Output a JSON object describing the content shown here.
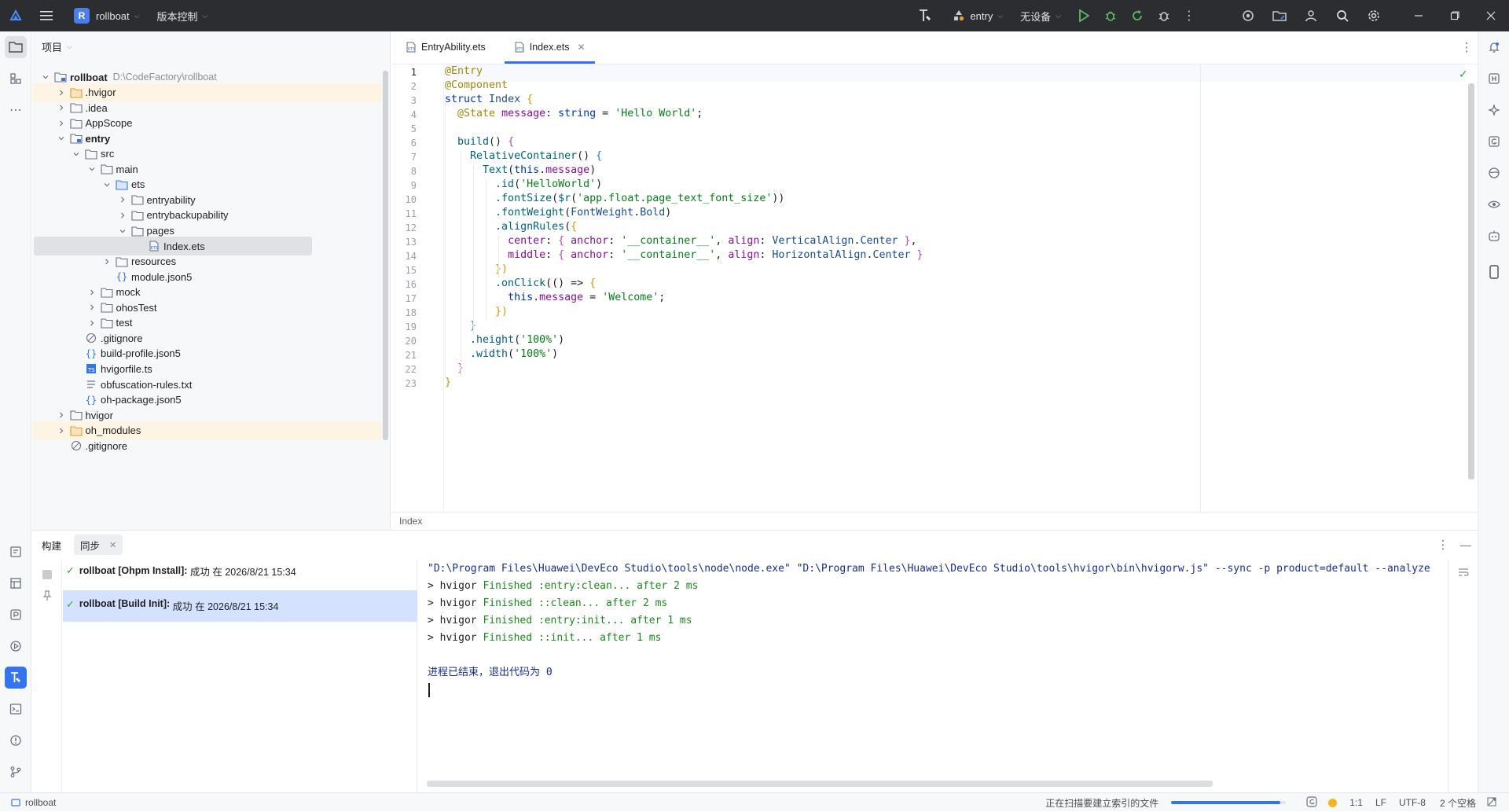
{
  "titlebar": {
    "project_name": "rollboat",
    "project_badge": "R",
    "vcs_label": "版本控制",
    "module": "entry",
    "device": "无设备"
  },
  "project_panel": {
    "title": "项目",
    "tree": [
      {
        "label": "rollboat",
        "hint": "D:\\CodeFactory\\rollboat",
        "depth": 0,
        "chevron": "down",
        "icon": "module-folder",
        "bold": true
      },
      {
        "label": ".hvigor",
        "depth": 1,
        "chevron": "right",
        "icon": "folder-orange",
        "highlight": true
      },
      {
        "label": ".idea",
        "depth": 1,
        "chevron": "right",
        "icon": "folder"
      },
      {
        "label": "AppScope",
        "depth": 1,
        "chevron": "right",
        "icon": "folder"
      },
      {
        "label": "entry",
        "depth": 1,
        "chevron": "down",
        "icon": "module-folder",
        "bold": true
      },
      {
        "label": "src",
        "depth": 2,
        "chevron": "down",
        "icon": "folder"
      },
      {
        "label": "main",
        "depth": 3,
        "chevron": "down",
        "icon": "folder"
      },
      {
        "label": "ets",
        "depth": 4,
        "chevron": "down",
        "icon": "folder-blue"
      },
      {
        "label": "entryability",
        "depth": 5,
        "chevron": "right",
        "icon": "folder"
      },
      {
        "label": "entrybackupability",
        "depth": 5,
        "chevron": "right",
        "icon": "folder"
      },
      {
        "label": "pages",
        "depth": 5,
        "chevron": "down",
        "icon": "folder"
      },
      {
        "label": "Index.ets",
        "depth": 6,
        "chevron": "",
        "icon": "ets-file",
        "selected": true
      },
      {
        "label": "resources",
        "depth": 4,
        "chevron": "right",
        "icon": "folder"
      },
      {
        "label": "module.json5",
        "depth": 4,
        "chevron": "",
        "icon": "json-file"
      },
      {
        "label": "mock",
        "depth": 3,
        "chevron": "right",
        "icon": "folder"
      },
      {
        "label": "ohosTest",
        "depth": 3,
        "chevron": "right",
        "icon": "folder"
      },
      {
        "label": "test",
        "depth": 3,
        "chevron": "right",
        "icon": "folder"
      },
      {
        "label": ".gitignore",
        "depth": 2,
        "chevron": "",
        "icon": "ignore-file"
      },
      {
        "label": "build-profile.json5",
        "depth": 2,
        "chevron": "",
        "icon": "json-file"
      },
      {
        "label": "hvigorfile.ts",
        "depth": 2,
        "chevron": "",
        "icon": "ts-file"
      },
      {
        "label": "obfuscation-rules.txt",
        "depth": 2,
        "chevron": "",
        "icon": "text-file"
      },
      {
        "label": "oh-package.json5",
        "depth": 2,
        "chevron": "",
        "icon": "json-file"
      },
      {
        "label": "hvigor",
        "depth": 1,
        "chevron": "right",
        "icon": "folder"
      },
      {
        "label": "oh_modules",
        "depth": 1,
        "chevron": "right",
        "icon": "folder-orange",
        "highlight": true
      },
      {
        "label": ".gitignore",
        "depth": 1,
        "chevron": "",
        "icon": "ignore-file"
      }
    ]
  },
  "editor": {
    "tabs": [
      {
        "label": "EntryAbility.ets",
        "active": false
      },
      {
        "label": "Index.ets",
        "active": true
      }
    ],
    "breadcrumb": "Index",
    "lines": [
      [
        {
          "t": "@Entry",
          "c": "dec"
        }
      ],
      [
        {
          "t": "@Component",
          "c": "dec"
        }
      ],
      [
        {
          "t": "struct ",
          "c": "kw"
        },
        {
          "t": "Index ",
          "c": "ty"
        },
        {
          "t": "{",
          "c": "br1"
        }
      ],
      [
        {
          "t": "  ",
          "c": "pl"
        },
        {
          "t": "@State ",
          "c": "dec"
        },
        {
          "t": "message",
          "c": "fld"
        },
        {
          "t": ": ",
          "c": "pl"
        },
        {
          "t": "string",
          "c": "kw"
        },
        {
          "t": " = ",
          "c": "pl"
        },
        {
          "t": "'Hello World'",
          "c": "str"
        },
        {
          "t": ";",
          "c": "pl"
        }
      ],
      [],
      [
        {
          "t": "  ",
          "c": "pl"
        },
        {
          "t": "build",
          "c": "fn"
        },
        {
          "t": "() ",
          "c": "pl"
        },
        {
          "t": "{",
          "c": "br2"
        }
      ],
      [
        {
          "t": "    ",
          "c": "pl"
        },
        {
          "t": "RelativeContainer",
          "c": "fn"
        },
        {
          "t": "() ",
          "c": "pl"
        },
        {
          "t": "{",
          "c": "br3"
        }
      ],
      [
        {
          "t": "      ",
          "c": "pl"
        },
        {
          "t": "Text",
          "c": "fn"
        },
        {
          "t": "(",
          "c": "pl"
        },
        {
          "t": "this",
          "c": "kw"
        },
        {
          "t": ".",
          "c": "pl"
        },
        {
          "t": "message",
          "c": "fld"
        },
        {
          "t": ")",
          "c": "pl"
        }
      ],
      [
        {
          "t": "        ",
          "c": "pl"
        },
        {
          "t": ".id",
          "c": "fn"
        },
        {
          "t": "(",
          "c": "pl"
        },
        {
          "t": "'HelloWorld'",
          "c": "str"
        },
        {
          "t": ")",
          "c": "pl"
        }
      ],
      [
        {
          "t": "        ",
          "c": "pl"
        },
        {
          "t": ".fontSize",
          "c": "fn"
        },
        {
          "t": "(",
          "c": "pl"
        },
        {
          "t": "$r",
          "c": "fn"
        },
        {
          "t": "(",
          "c": "pl"
        },
        {
          "t": "'app.float.page_text_font_size'",
          "c": "str"
        },
        {
          "t": "))",
          "c": "pl"
        }
      ],
      [
        {
          "t": "        ",
          "c": "pl"
        },
        {
          "t": ".fontWeight",
          "c": "fn"
        },
        {
          "t": "(",
          "c": "pl"
        },
        {
          "t": "FontWeight",
          "c": "ty"
        },
        {
          "t": ".",
          "c": "pl"
        },
        {
          "t": "Bold",
          "c": "ty"
        },
        {
          "t": ")",
          "c": "pl"
        }
      ],
      [
        {
          "t": "        ",
          "c": "pl"
        },
        {
          "t": ".alignRules",
          "c": "fn"
        },
        {
          "t": "(",
          "c": "pl"
        },
        {
          "t": "{",
          "c": "br1"
        }
      ],
      [
        {
          "t": "          ",
          "c": "pl"
        },
        {
          "t": "center",
          "c": "fld"
        },
        {
          "t": ": ",
          "c": "pl"
        },
        {
          "t": "{ ",
          "c": "br2"
        },
        {
          "t": "anchor",
          "c": "fld"
        },
        {
          "t": ": ",
          "c": "pl"
        },
        {
          "t": "'__container__'",
          "c": "str"
        },
        {
          "t": ", ",
          "c": "pl"
        },
        {
          "t": "align",
          "c": "fld"
        },
        {
          "t": ": ",
          "c": "pl"
        },
        {
          "t": "VerticalAlign",
          "c": "ty"
        },
        {
          "t": ".",
          "c": "pl"
        },
        {
          "t": "Center ",
          "c": "ty"
        },
        {
          "t": "}",
          "c": "br2"
        },
        {
          "t": ",",
          "c": "pl"
        }
      ],
      [
        {
          "t": "          ",
          "c": "pl"
        },
        {
          "t": "middle",
          "c": "fld"
        },
        {
          "t": ": ",
          "c": "pl"
        },
        {
          "t": "{ ",
          "c": "br2"
        },
        {
          "t": "anchor",
          "c": "fld"
        },
        {
          "t": ": ",
          "c": "pl"
        },
        {
          "t": "'__container__'",
          "c": "str"
        },
        {
          "t": ", ",
          "c": "pl"
        },
        {
          "t": "align",
          "c": "fld"
        },
        {
          "t": ": ",
          "c": "pl"
        },
        {
          "t": "HorizontalAlign",
          "c": "ty"
        },
        {
          "t": ".",
          "c": "pl"
        },
        {
          "t": "Center ",
          "c": "ty"
        },
        {
          "t": "}",
          "c": "br2"
        }
      ],
      [
        {
          "t": "        ",
          "c": "pl"
        },
        {
          "t": "})",
          "c": "br1"
        }
      ],
      [
        {
          "t": "        ",
          "c": "pl"
        },
        {
          "t": ".onClick",
          "c": "fn"
        },
        {
          "t": "(",
          "c": "pl"
        },
        {
          "t": "() => ",
          "c": "pl"
        },
        {
          "t": "{",
          "c": "br1"
        }
      ],
      [
        {
          "t": "          ",
          "c": "pl"
        },
        {
          "t": "this",
          "c": "kw"
        },
        {
          "t": ".",
          "c": "pl"
        },
        {
          "t": "message",
          "c": "fld"
        },
        {
          "t": " = ",
          "c": "pl"
        },
        {
          "t": "'Welcome'",
          "c": "str"
        },
        {
          "t": ";",
          "c": "pl"
        }
      ],
      [
        {
          "t": "        ",
          "c": "pl"
        },
        {
          "t": "})",
          "c": "br1"
        }
      ],
      [
        {
          "t": "    ",
          "c": "pl"
        },
        {
          "t": "}",
          "c": "br3"
        }
      ],
      [
        {
          "t": "    ",
          "c": "pl"
        },
        {
          "t": ".height",
          "c": "fn"
        },
        {
          "t": "(",
          "c": "pl"
        },
        {
          "t": "'100%'",
          "c": "str"
        },
        {
          "t": ")",
          "c": "pl"
        }
      ],
      [
        {
          "t": "    ",
          "c": "pl"
        },
        {
          "t": ".width",
          "c": "fn"
        },
        {
          "t": "(",
          "c": "pl"
        },
        {
          "t": "'100%'",
          "c": "str"
        },
        {
          "t": ")",
          "c": "pl"
        }
      ],
      [
        {
          "t": "  ",
          "c": "pl"
        },
        {
          "t": "}",
          "c": "br2"
        }
      ],
      [
        {
          "t": "}",
          "c": "br1"
        }
      ]
    ]
  },
  "build_panel": {
    "tabs": [
      {
        "label": "构建",
        "active": false
      },
      {
        "label": "同步",
        "active": true
      }
    ],
    "items": [
      {
        "title": "rollboat [Ohpm Install]:",
        "detail": " 成功 在 2026/8/21 15:34",
        "selected": false
      },
      {
        "title": "rollboat [Build Init]:",
        "detail": " 成功 在 2026/8/21 15:34",
        "selected": true
      }
    ],
    "console": [
      {
        "text": "\"D:\\Program Files\\Huawei\\DevEco Studio\\tools\\node\\node.exe\" \"D:\\Program Files\\Huawei\\DevEco Studio\\tools\\hvigor\\bin\\hvigorw.js\" --sync -p product=default --analyze",
        "kind": "cmd"
      },
      {
        "prefix": "> hvigor ",
        "text": "Finished :entry:clean... after 2 ms",
        "kind": "ok"
      },
      {
        "prefix": "> hvigor ",
        "text": "Finished ::clean... after 2 ms",
        "kind": "ok"
      },
      {
        "prefix": "> hvigor ",
        "text": "Finished :entry:init... after 1 ms",
        "kind": "ok"
      },
      {
        "prefix": "> hvigor ",
        "text": "Finished ::init... after 1 ms",
        "kind": "ok"
      },
      {
        "text": "",
        "kind": "blank"
      },
      {
        "text": "进程已结束，退出代码为 0",
        "kind": "info"
      }
    ]
  },
  "statusbar": {
    "project": "rollboat",
    "indexing": "正在扫描要建立索引的文件",
    "indexing_progress": 0.95,
    "position": "1:1",
    "line_sep": "LF",
    "encoding": "UTF-8",
    "indent": "2 个空格"
  },
  "colors": {
    "accent": "#3574f0",
    "success": "#36a336",
    "titlebar_bg": "#2b2d30",
    "highlight_row": "#fdf4e3",
    "selected_row": "#dfe1e5",
    "selected_build": "#d4e2ff"
  }
}
